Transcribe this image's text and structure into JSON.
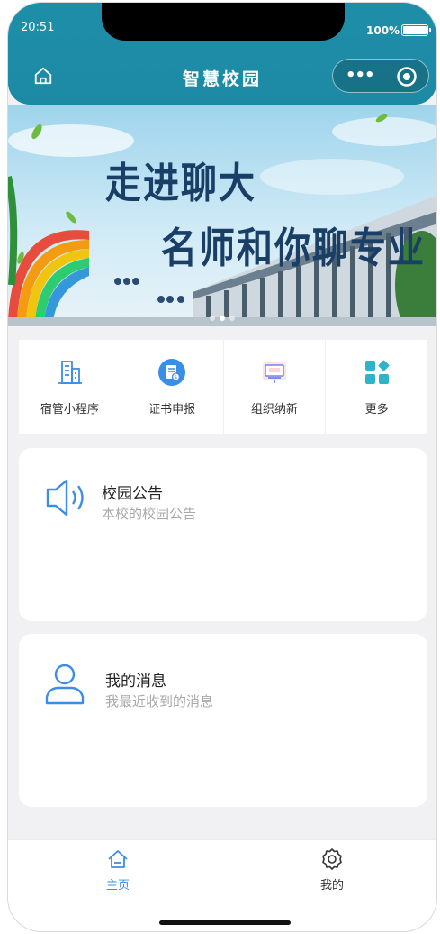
{
  "status_bar": {
    "time": "20:51",
    "battery": "100%"
  },
  "nav": {
    "title": "智慧校园",
    "more_glyph": "•••"
  },
  "banner": {
    "line1": "走进聊大",
    "line2": "名师和你聊专业",
    "page_count": 3,
    "active_page": 1
  },
  "grid": [
    {
      "label": "宿管小程序",
      "icon": "building-icon"
    },
    {
      "label": "证书申报",
      "icon": "document-icon"
    },
    {
      "label": "组织纳新",
      "icon": "new-monitor-icon"
    },
    {
      "label": "更多",
      "icon": "more-apps-icon"
    }
  ],
  "cards": [
    {
      "title": "校园公告",
      "subtitle": "本校的校园公告",
      "icon": "speaker-icon"
    },
    {
      "title": "我的消息",
      "subtitle": "我最近收到的消息",
      "icon": "user-icon"
    }
  ],
  "tabbar": [
    {
      "label": "主页",
      "icon": "home-icon",
      "active": true
    },
    {
      "label": "我的",
      "icon": "gear-icon",
      "active": false
    }
  ],
  "colors": {
    "header": "#1e8ea8",
    "accent": "#3a8ee6",
    "tab_active": "#3a8ee6",
    "tab_inactive": "#333333"
  }
}
